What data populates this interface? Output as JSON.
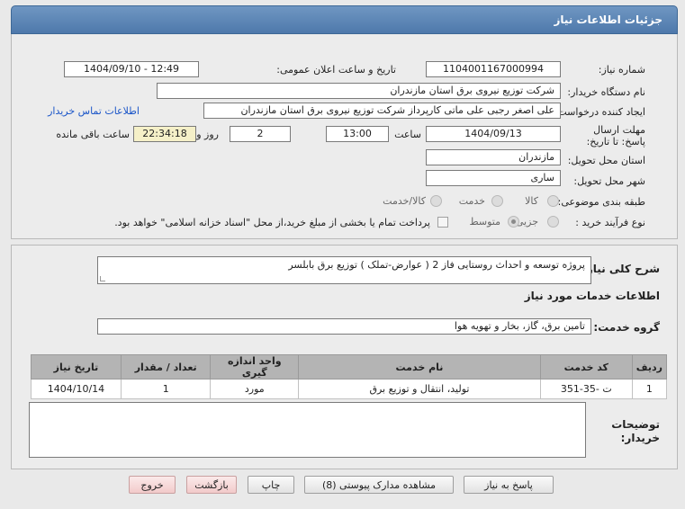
{
  "header": {
    "title": "جزئیات اطلاعات نیاز"
  },
  "form": {
    "need_number_label": "شماره نیاز:",
    "need_number": "1104001167000994",
    "announce_label": "تاریخ و ساعت اعلان عمومی:",
    "announce_value": "1404/09/10 - 12:49",
    "buyer_org_label": "نام دستگاه خریدار:",
    "buyer_org": "شرکت توزیع نیروی برق استان مازندران",
    "creator_label": "ایجاد کننده درخواست:",
    "creator": "علی اصغر رجبی علی ماتی کارپرداز شرکت توزیع نیروی برق استان مازندران",
    "contact_link": "اطلاعات تماس خریدار",
    "deadline_label": "مهلت ارسال پاسخ: تا تاریخ:",
    "deadline_date": "1404/09/13",
    "time_label": "ساعت",
    "deadline_time": "13:00",
    "days_value": "2",
    "days_label": "روز و",
    "remaining_time": "22:34:18",
    "remaining_label": "ساعت باقی مانده",
    "province_label": "استان محل تحویل:",
    "province": "مازندران",
    "city_label": "شهر محل تحویل:",
    "city": "ساری",
    "category_label": "طبقه بندی موضوعی:",
    "category_options": [
      "کالا",
      "خدمت",
      "کالا/خدمت"
    ],
    "category_selected": "خدمت",
    "process_label": "نوع فرآیند خرید :",
    "process_options": [
      "جزیی",
      "متوسط"
    ],
    "process_selected": "متوسط",
    "payment_note": "پرداخت تمام یا بخشی از مبلغ خرید،از محل \"اسناد خزانه اسلامی\" خواهد بود."
  },
  "description": {
    "label": "شرح کلی نیاز:",
    "value": "پروژه توسعه و احداث روستایی فاز 2 ( عوارض-تملک ) توزیع برق بابلسر"
  },
  "services": {
    "section_title": "اطلاعات خدمات مورد نیاز",
    "group_label": "گروه خدمت:",
    "group_value": "تامین برق، گاز، بخار و تهویه هوا",
    "columns": [
      "ردیف",
      "کد خدمت",
      "نام خدمت",
      "واحد اندازه گیری",
      "تعداد / مقدار",
      "تاریخ نیاز"
    ],
    "rows": [
      [
        "1",
        "ت -35-351",
        "تولید، انتقال و توزیع برق",
        "مورد",
        "1",
        "1404/10/14"
      ]
    ]
  },
  "buyer_notes": {
    "label_line1": "توضیحات",
    "label_line2": "خریدار:"
  },
  "buttons": {
    "reply": "پاسخ به نیاز",
    "attachments": "مشاهده مدارک پیوستی (8)",
    "print": "چاپ",
    "back": "بازگشت",
    "exit": "خروج"
  },
  "colors": {
    "header": "#5a82b4",
    "link": "#1a55c8"
  }
}
